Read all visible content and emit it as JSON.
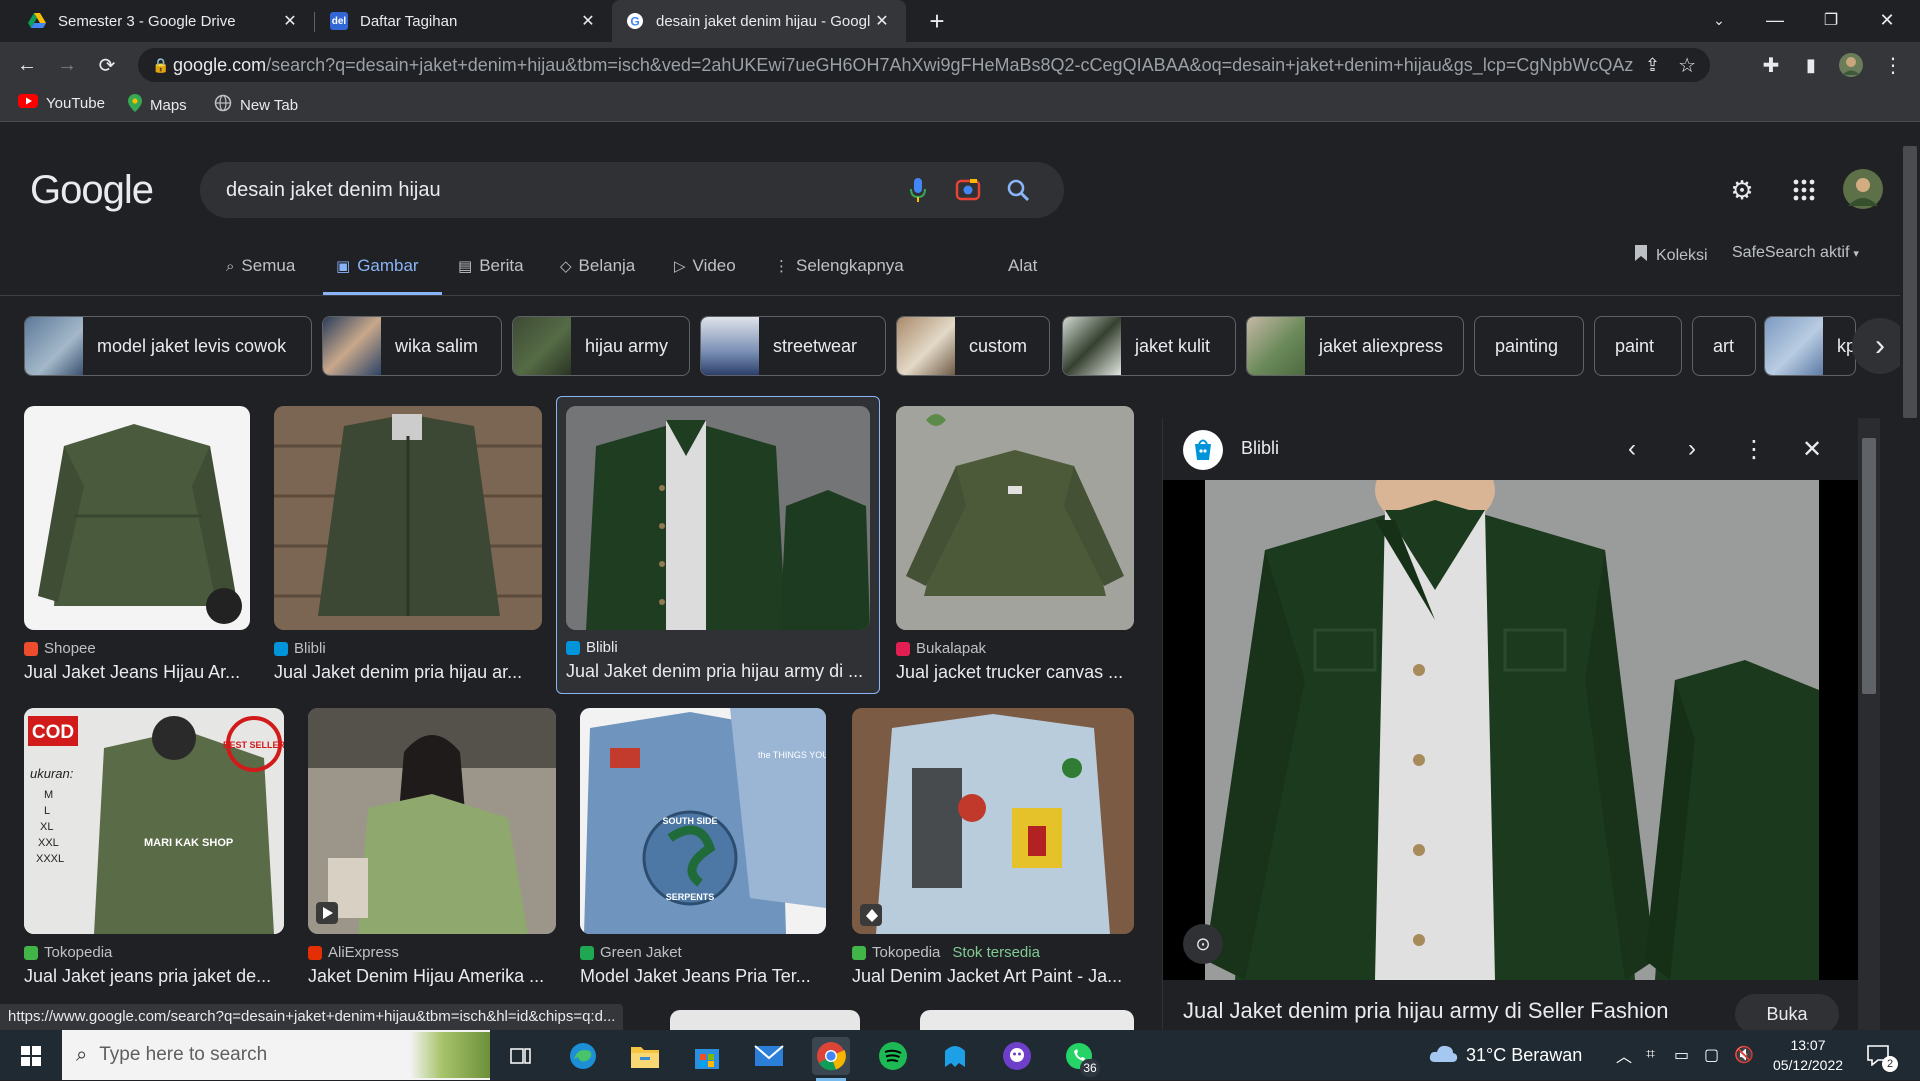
{
  "browser": {
    "tabs": [
      {
        "title": "Semester 3 - Google Drive",
        "icon": "google-drive-icon"
      },
      {
        "title": "Daftar Tagihan",
        "icon": "site-favicon-icon"
      },
      {
        "title": "desain jaket denim hijau - Googl",
        "icon": "google-icon",
        "active": true
      }
    ],
    "new_tab": "+",
    "address": {
      "host": "google.com",
      "path": "/search?q=desain+jaket+denim+hijau&tbm=isch&ved=2ahUKEwi7ueGH6OH7AhXwi9gFHeMaBs8Q2-cCegQIABAA&oq=desain+jaket+denim+hijau&gs_lcp=CgNpbWcQAzoECC..."
    },
    "bookmarks": [
      {
        "label": "YouTube",
        "icon": "youtube-icon"
      },
      {
        "label": "Maps",
        "icon": "maps-pin-icon"
      },
      {
        "label": "New Tab",
        "icon": "globe-icon"
      }
    ]
  },
  "google": {
    "logo": "Google",
    "query": "desain jaket denim hijau",
    "nav": [
      {
        "label": "Semua",
        "icon": "search-icon"
      },
      {
        "label": "Gambar",
        "icon": "image-icon",
        "active": true
      },
      {
        "label": "Berita",
        "icon": "news-icon"
      },
      {
        "label": "Belanja",
        "icon": "tag-icon"
      },
      {
        "label": "Video",
        "icon": "play-icon"
      },
      {
        "label": "Selengkapnya",
        "icon": "more-vert-icon"
      }
    ],
    "tools": "Alat",
    "collections": "Koleksi",
    "safesearch": "SafeSearch aktif",
    "chips": [
      {
        "label": "model jaket levis cowok",
        "image": true
      },
      {
        "label": "wika salim",
        "image": true
      },
      {
        "label": "hijau army",
        "image": true
      },
      {
        "label": "streetwear",
        "image": true
      },
      {
        "label": "custom",
        "image": true
      },
      {
        "label": "jaket kulit",
        "image": true
      },
      {
        "label": "jaket aliexpress",
        "image": true
      },
      {
        "label": "painting",
        "image": false
      },
      {
        "label": "paint",
        "image": false
      },
      {
        "label": "art",
        "image": false
      },
      {
        "label": "kp",
        "image": true
      }
    ],
    "results_row1": [
      {
        "source": "Shopee",
        "title": "Jual Jaket Jeans Hijau Ar..."
      },
      {
        "source": "Blibli",
        "title": "Jual Jaket denim pria hijau ar..."
      },
      {
        "source": "Blibli",
        "title": "Jual Jaket denim pria hijau army di ...",
        "selected": true
      },
      {
        "source": "Bukalapak",
        "title": "Jual jacket trucker canvas ..."
      }
    ],
    "results_row2": [
      {
        "source": "Tokopedia",
        "title": "Jual Jaket jeans pria jaket de..."
      },
      {
        "source": "AliExpress",
        "title": "Jaket Denim Hijau Amerika ..."
      },
      {
        "source": "Green Jaket",
        "title": "Model Jaket Jeans Pria Ter..."
      },
      {
        "source": "Tokopedia",
        "stock": "Stok tersedia",
        "title": "Jual Denim Jacket Art Paint - Ja..."
      }
    ],
    "thumb_overlays": {
      "cod": "COD",
      "best_seller": "BEST SELLER",
      "ukuran": "ukuran:",
      "sizes": [
        "M",
        "L",
        "XL",
        "XXL",
        "XXXL"
      ],
      "shop": "MARI KAK SHOP",
      "patch1": "SOUTH SIDE",
      "patch2": "SERPENTS",
      "patch3": "the THINGS YOU SAY YES TO"
    },
    "panel": {
      "site": "Blibli",
      "title": "Jual Jaket denim pria hijau army di Seller Fashion",
      "visit": "Buka"
    },
    "status_url": "https://www.google.com/search?q=desain+jaket+denim+hijau&tbm=isch&hl=id&chips=q:d..."
  },
  "taskbar": {
    "search_placeholder": "Type here to search",
    "weather": "31°C  Berawan",
    "time": "13:07",
    "date": "05/12/2022",
    "whatsapp_badge": "36",
    "notif_count": "2"
  }
}
